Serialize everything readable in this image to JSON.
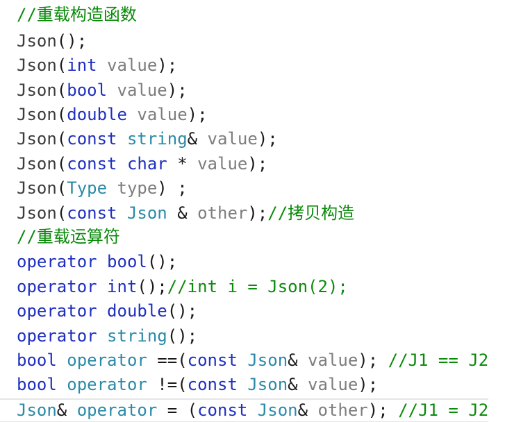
{
  "lines": [
    [
      {
        "t": "//重载构造函数",
        "c": "comment"
      }
    ],
    [
      {
        "t": "Json",
        "c": "fn"
      },
      {
        "t": "();",
        "c": "op"
      }
    ],
    [
      {
        "t": "Json",
        "c": "fn"
      },
      {
        "t": "(",
        "c": "op"
      },
      {
        "t": "int",
        "c": "keyword"
      },
      {
        "t": " value",
        "c": "param"
      },
      {
        "t": ");",
        "c": "op"
      }
    ],
    [
      {
        "t": "Json",
        "c": "fn"
      },
      {
        "t": "(",
        "c": "op"
      },
      {
        "t": "bool",
        "c": "keyword"
      },
      {
        "t": " value",
        "c": "param"
      },
      {
        "t": ");",
        "c": "op"
      }
    ],
    [
      {
        "t": "Json",
        "c": "fn"
      },
      {
        "t": "(",
        "c": "op"
      },
      {
        "t": "double",
        "c": "keyword"
      },
      {
        "t": " value",
        "c": "param"
      },
      {
        "t": ");",
        "c": "op"
      }
    ],
    [
      {
        "t": "Json",
        "c": "fn"
      },
      {
        "t": "(",
        "c": "op"
      },
      {
        "t": "const",
        "c": "keyword"
      },
      {
        "t": " ",
        "c": "op"
      },
      {
        "t": "string",
        "c": "type"
      },
      {
        "t": "&",
        "c": "op"
      },
      {
        "t": " value",
        "c": "param"
      },
      {
        "t": ");",
        "c": "op"
      }
    ],
    [
      {
        "t": "Json",
        "c": "fn"
      },
      {
        "t": "(",
        "c": "op"
      },
      {
        "t": "const",
        "c": "keyword"
      },
      {
        "t": " ",
        "c": "op"
      },
      {
        "t": "char",
        "c": "keyword"
      },
      {
        "t": " * ",
        "c": "op"
      },
      {
        "t": "value",
        "c": "param"
      },
      {
        "t": ");",
        "c": "op"
      }
    ],
    [
      {
        "t": "Json",
        "c": "fn"
      },
      {
        "t": "(",
        "c": "op"
      },
      {
        "t": "Type",
        "c": "type"
      },
      {
        "t": " type",
        "c": "param"
      },
      {
        "t": ") ;",
        "c": "op"
      }
    ],
    [
      {
        "t": "Json",
        "c": "fn"
      },
      {
        "t": "(",
        "c": "op"
      },
      {
        "t": "const",
        "c": "keyword"
      },
      {
        "t": " ",
        "c": "op"
      },
      {
        "t": "Json",
        "c": "type"
      },
      {
        "t": " & ",
        "c": "op"
      },
      {
        "t": "other",
        "c": "param"
      },
      {
        "t": ");",
        "c": "op"
      },
      {
        "t": "//拷贝构造",
        "c": "comment"
      }
    ],
    [
      {
        "t": "//重载运算符",
        "c": "comment"
      }
    ],
    [
      {
        "t": "operator",
        "c": "keyword"
      },
      {
        "t": " ",
        "c": "op"
      },
      {
        "t": "bool",
        "c": "keyword"
      },
      {
        "t": "();",
        "c": "op"
      }
    ],
    [
      {
        "t": "operator",
        "c": "keyword"
      },
      {
        "t": " ",
        "c": "op"
      },
      {
        "t": "int",
        "c": "keyword"
      },
      {
        "t": "();",
        "c": "op"
      },
      {
        "t": "//int i = Json(2);",
        "c": "comment"
      }
    ],
    [
      {
        "t": "operator",
        "c": "keyword"
      },
      {
        "t": " ",
        "c": "op"
      },
      {
        "t": "double",
        "c": "keyword"
      },
      {
        "t": "();",
        "c": "op"
      }
    ],
    [
      {
        "t": "operator",
        "c": "keyword"
      },
      {
        "t": " ",
        "c": "op"
      },
      {
        "t": "string",
        "c": "type"
      },
      {
        "t": "();",
        "c": "op"
      }
    ],
    [
      {
        "t": "bool",
        "c": "keyword"
      },
      {
        "t": " ",
        "c": "op"
      },
      {
        "t": "operator",
        "c": "type"
      },
      {
        "t": " ==(",
        "c": "op"
      },
      {
        "t": "const",
        "c": "keyword"
      },
      {
        "t": " ",
        "c": "op"
      },
      {
        "t": "Json",
        "c": "type"
      },
      {
        "t": "&",
        "c": "op"
      },
      {
        "t": " value",
        "c": "param"
      },
      {
        "t": "); ",
        "c": "op"
      },
      {
        "t": "//J1 == J2",
        "c": "comment"
      }
    ],
    [
      {
        "t": "bool",
        "c": "keyword"
      },
      {
        "t": " ",
        "c": "op"
      },
      {
        "t": "operator",
        "c": "type"
      },
      {
        "t": " !=(",
        "c": "op"
      },
      {
        "t": "const",
        "c": "keyword"
      },
      {
        "t": " ",
        "c": "op"
      },
      {
        "t": "Json",
        "c": "type"
      },
      {
        "t": "&",
        "c": "op"
      },
      {
        "t": " value",
        "c": "param"
      },
      {
        "t": ");",
        "c": "op"
      }
    ],
    [
      {
        "t": "Json",
        "c": "type"
      },
      {
        "t": "& ",
        "c": "op"
      },
      {
        "t": "operator",
        "c": "type"
      },
      {
        "t": " = (",
        "c": "op"
      },
      {
        "t": "const",
        "c": "keyword"
      },
      {
        "t": " ",
        "c": "op"
      },
      {
        "t": "Json",
        "c": "type"
      },
      {
        "t": "&",
        "c": "op"
      },
      {
        "t": " other",
        "c": "param"
      },
      {
        "t": "); ",
        "c": "op"
      },
      {
        "t": "//J1 = J2",
        "c": "comment"
      }
    ]
  ],
  "current_line": 16,
  "colors": {
    "comment": "#0b8a0b",
    "keyword": "#1f2fbf",
    "type": "#2a8aa8",
    "param": "#7d7d7d",
    "function": "#3b3b3b"
  }
}
